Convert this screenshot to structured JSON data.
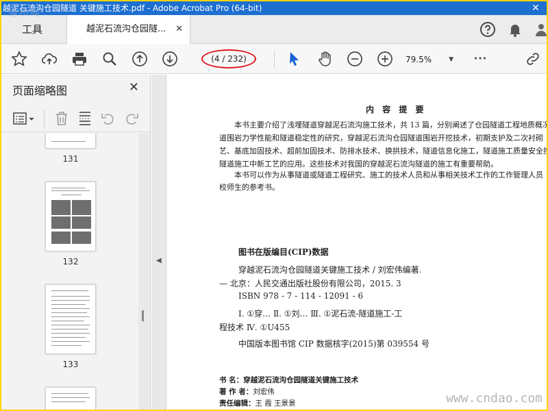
{
  "window": {
    "title": "越泥石流沟仓园隧道 关键施工技术.pdf - Adobe Acrobat Pro (64-bit)",
    "close_glyph": "✕",
    "watermark_top": "道桥网"
  },
  "tabs": {
    "tools_label": "工具",
    "document_label": "越泥石流沟仓园隧...",
    "document_close": "✕"
  },
  "toolbar": {
    "page_display": "(4 / 232)",
    "zoom_value": "79.5%",
    "zoom_caret": "▼",
    "more_glyph": "•••"
  },
  "icons": {
    "bookmark": "star-icon",
    "upload": "cloud-upload-icon",
    "print": "printer-icon",
    "search": "magnifier-icon",
    "prev_page": "arrow-up-circle-icon",
    "next_page": "arrow-down-circle-icon",
    "select": "cursor-arrow-icon",
    "hand": "hand-icon",
    "zoom_out": "minus-circle-icon",
    "zoom_in": "plus-circle-icon",
    "share_link": "link-icon",
    "help": "help-icon",
    "notifications": "bell-icon"
  },
  "panel": {
    "title": "页面缩略图",
    "close_glyph": "✕",
    "thumbnails": [
      {
        "label": "131"
      },
      {
        "label": "132"
      },
      {
        "label": "133"
      }
    ]
  },
  "collapse_arrow": "◀",
  "document": {
    "abstract_title": "内 容 提 要",
    "paragraph1_lines": [
      "本书主要介绍了浅埋隧道穿越泥石流沟施工技术，共 13 篇，分别阐述了仓园隧道工程地质概况",
      "道围岩力学性能和隧道稳定性的研究，穿越泥石流沟仓园隧道围岩开挖技术，初期支护及二次衬砌",
      "艺、基底加固技术、超前加固技术、防排水技术、换拱技术，隧道信息化施工，隧道施工质量安全控制措",
      "隧道施工中新工艺的应用。这些技术对我国的穿越泥石流沟隧道的施工有重要帮助。"
    ],
    "paragraph2_lines": [
      "本书可以作为从事隧道或隧道工程研究、施工的技术人员和从事相关技术工作的工作管理人员",
      "校师生的参考书。"
    ],
    "cip_title": "图书在版编目(CIP)数据",
    "cip_lines": [
      "穿越泥石流沟仓园隧道关键施工技术 / 刘宏伟编著.",
      "— 北京：人民交通出版社股份有限公司，2015. 3",
      "ISBN 978 - 7 - 114 - 12091 - 6",
      "Ⅰ. ①穿…   Ⅱ. ①刘…   Ⅲ. ①泥石流-隧道施工-工",
      "程技术   Ⅳ. ①U455",
      "中国版本图书馆 CIP 数据核字(2015)第 039554 号"
    ],
    "book_info": [
      {
        "label": "书      名：",
        "value": "穿越泥石流沟仓园隧道关键施工技术",
        "bold": true
      },
      {
        "label": "著  作  者：",
        "value": "刘宏伟",
        "bold": false
      },
      {
        "label": "责任编辑：",
        "value": "王   霞   王景景",
        "bold": false
      }
    ]
  },
  "watermark_bottom": "www.cndao.com"
}
